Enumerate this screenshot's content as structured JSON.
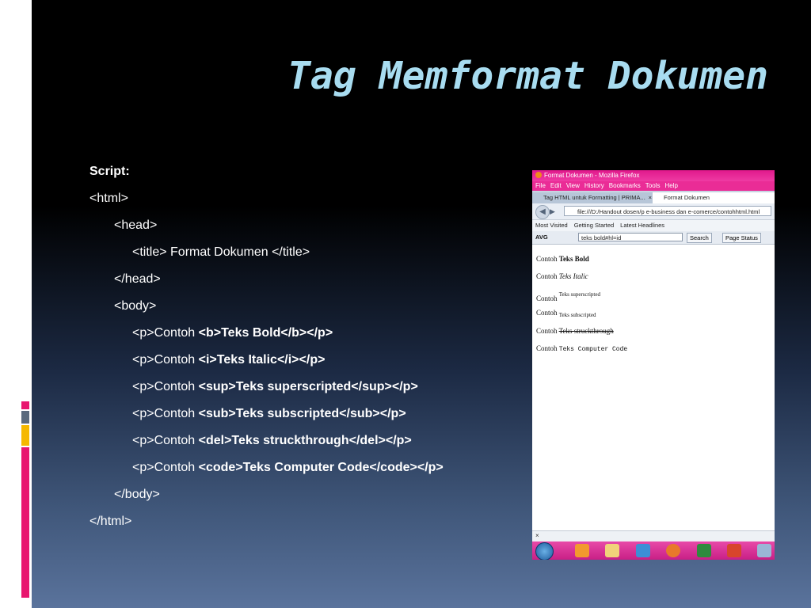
{
  "slide": {
    "title": "Tag Memformat Dokumen",
    "code_lines": [
      {
        "indent": 0,
        "plain": "Script:",
        "bold_all": true
      },
      {
        "indent": 0,
        "plain": "<html>"
      },
      {
        "indent": 1,
        "plain": "<head>"
      },
      {
        "indent": 2,
        "plain": "<title> Format Dokumen </title>"
      },
      {
        "indent": 1,
        "plain": "</head>"
      },
      {
        "indent": 1,
        "plain": "<body>"
      },
      {
        "indent": 2,
        "plain": "<p>Contoh ",
        "bold": "<b>Teks Bold</b></p>"
      },
      {
        "indent": 2,
        "plain": "<p>Contoh ",
        "bold": "<i>Teks Italic</i></p>"
      },
      {
        "indent": 2,
        "plain": "<p>Contoh ",
        "bold": "<sup>Teks superscripted</sup></p>"
      },
      {
        "indent": 2,
        "plain": "<p>Contoh ",
        "bold": "<sub>Teks subscripted</sub></p>"
      },
      {
        "indent": 2,
        "plain": "<p>Contoh ",
        "bold": "<del>Teks struckthrough</del></p>"
      },
      {
        "indent": 2,
        "plain": "<p>Contoh ",
        "bold": "<code>Teks Computer Code</code></p>"
      },
      {
        "indent": 1,
        "plain": "</body>"
      },
      {
        "indent": 0,
        "plain": "</html>"
      }
    ]
  },
  "browser": {
    "window_title": "Format Dokumen - Mozilla Firefox",
    "menu": [
      "File",
      "Edit",
      "View",
      "History",
      "Bookmarks",
      "Tools",
      "Help"
    ],
    "tabs": [
      {
        "label": "Tag HTML untuk Formatting | PRIMA...",
        "close": "×"
      },
      {
        "label": "Format Dokumen",
        "close": "×"
      }
    ],
    "url": "file:///D:/Handout dosen/p e-business dan e-comerce/contohhtml.html",
    "bookmarks": [
      "Most Visited",
      "Getting Started",
      "Latest Headlines"
    ],
    "avg": {
      "logo": "AVG",
      "search_value": "teks bold#hl=id",
      "search_button": "Search",
      "page_status": "Page Status"
    },
    "content": {
      "prefix": "Contoh",
      "bold": "Teks Bold",
      "italic": "Teks Italic",
      "sup": "Teks superscripted",
      "sub": "Teks subscripted",
      "del": "Teks struckthrough",
      "code": "Teks Computer Code"
    },
    "status_close": "×"
  },
  "colors": {
    "title": "#a8dcf0",
    "deco": [
      "#e8166f",
      "#5a6a7e",
      "#f5b800",
      "#e8166f"
    ]
  }
}
